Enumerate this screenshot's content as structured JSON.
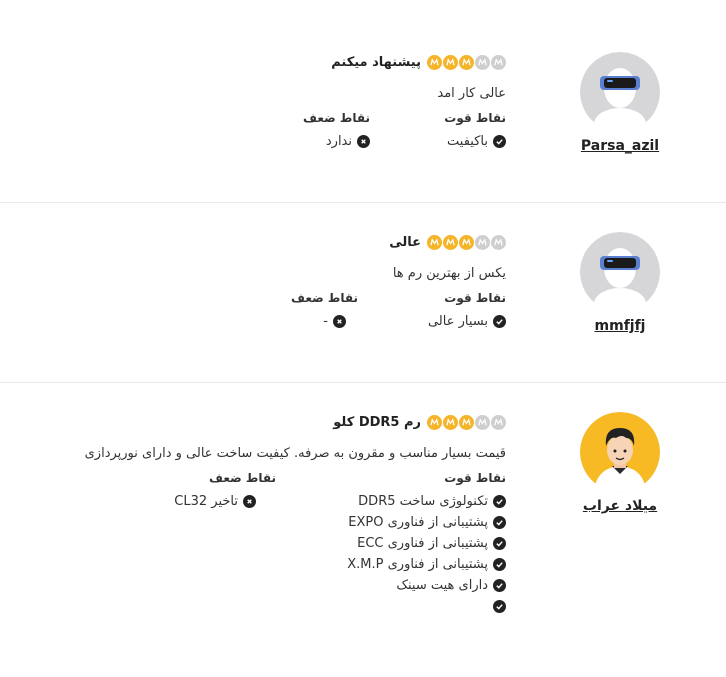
{
  "labels": {
    "pros": "نقاط قوت",
    "cons": "نقاط ضعف"
  },
  "colors": {
    "star_on": "#f5b52a",
    "star_off": "#cfcfcf",
    "divider": "#e9e9e9"
  },
  "reviews": [
    {
      "username": "Parsa_azil",
      "avatar": "vr-headset-avatar-icon",
      "rating": 3,
      "max_rating": 5,
      "title": "پیشنهاد میکنم",
      "comment": "عالی کار امد",
      "pros": [
        "باکیفیت"
      ],
      "cons": [
        "ندارد"
      ]
    },
    {
      "username": "mmfjfj",
      "avatar": "vr-headset-avatar-icon",
      "rating": 3,
      "max_rating": 5,
      "title": "عالی",
      "comment": "یکس از بهترین رم ها",
      "pros": [
        "بسیار عالی"
      ],
      "cons": [
        "-"
      ]
    },
    {
      "username": "میلاد عراب",
      "avatar": "man-avatar-icon",
      "rating": 3,
      "max_rating": 5,
      "title": "رم DDR5 کلو",
      "comment": "قیمت بسیار مناسب و مقرون به صرفه. کیفیت ساخت عالی و دارای نورپردازی",
      "pros": [
        "تکنولوژی ساخت DDR5",
        "پشتیبانی از فناوری EXPO",
        "پشتیبانی از فناوری ECC",
        "پشتیبانی از فناوری X.M.P",
        "دارای هیت سینک",
        ""
      ],
      "cons": [
        "تاخیر CL32"
      ]
    }
  ]
}
